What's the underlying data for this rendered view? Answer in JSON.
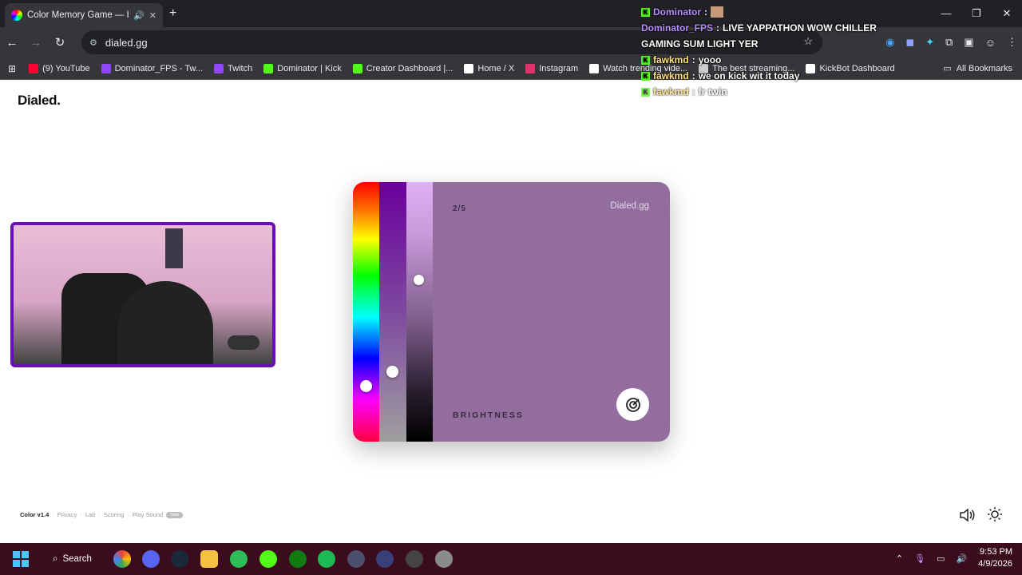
{
  "browser": {
    "tab_title": "Color Memory Game — Ho",
    "url": "dialed.gg",
    "bookmarks": [
      {
        "label": "(9) YouTube",
        "icon": "youtube-icon",
        "color": "#ff0033"
      },
      {
        "label": "Dominator_FPS - Tw...",
        "icon": "twitch-icon",
        "color": "#9146ff"
      },
      {
        "label": "Twitch",
        "icon": "twitch-icon",
        "color": "#9146ff"
      },
      {
        "label": "Dominator | Kick",
        "icon": "kick-icon",
        "color": "#53fc18"
      },
      {
        "label": "Creator Dashboard |...",
        "icon": "kick-icon",
        "color": "#53fc18"
      },
      {
        "label": "Home / X",
        "icon": "x-icon",
        "color": "#ffffff"
      },
      {
        "label": "Instagram",
        "icon": "instagram-icon",
        "color": "#e1306c"
      },
      {
        "label": "Watch trending vide...",
        "icon": "tiktok-icon",
        "color": "#ffffff"
      },
      {
        "label": "The best streaming...",
        "icon": "streaming-icon",
        "color": "#cccccc"
      },
      {
        "label": "KickBot Dashboard",
        "icon": "kickbot-icon",
        "color": "#ffffff"
      }
    ],
    "all_bookmarks": "All Bookmarks"
  },
  "page": {
    "logo": "Dialed.",
    "game": {
      "counter": "2/5",
      "brand": "Dialed.gg",
      "parameter": "BRIGHTNESS",
      "swatch_color": "#936d9e"
    },
    "footer": {
      "version": "Color v1.4",
      "links": [
        "Privacy",
        "Lab",
        "Scoring",
        "Play Sound"
      ],
      "badge": "new"
    }
  },
  "chat": [
    {
      "user": "Dominator",
      "message": ""
    },
    {
      "user": "Dominator_FPS",
      "message": "LIVE YAPPATHON WOW CHILLER"
    },
    {
      "user": "",
      "message": "GAMING SUM LIGHT YER"
    },
    {
      "user": "fawkmd",
      "message": "yooo"
    },
    {
      "user": "fawkmd",
      "message": "we on kick wit it today"
    },
    {
      "user": "fawkmd",
      "message": "fr twin"
    }
  ],
  "taskbar": {
    "search_label": "Search",
    "time": "9:53 PM",
    "date": "4/9/2026"
  }
}
